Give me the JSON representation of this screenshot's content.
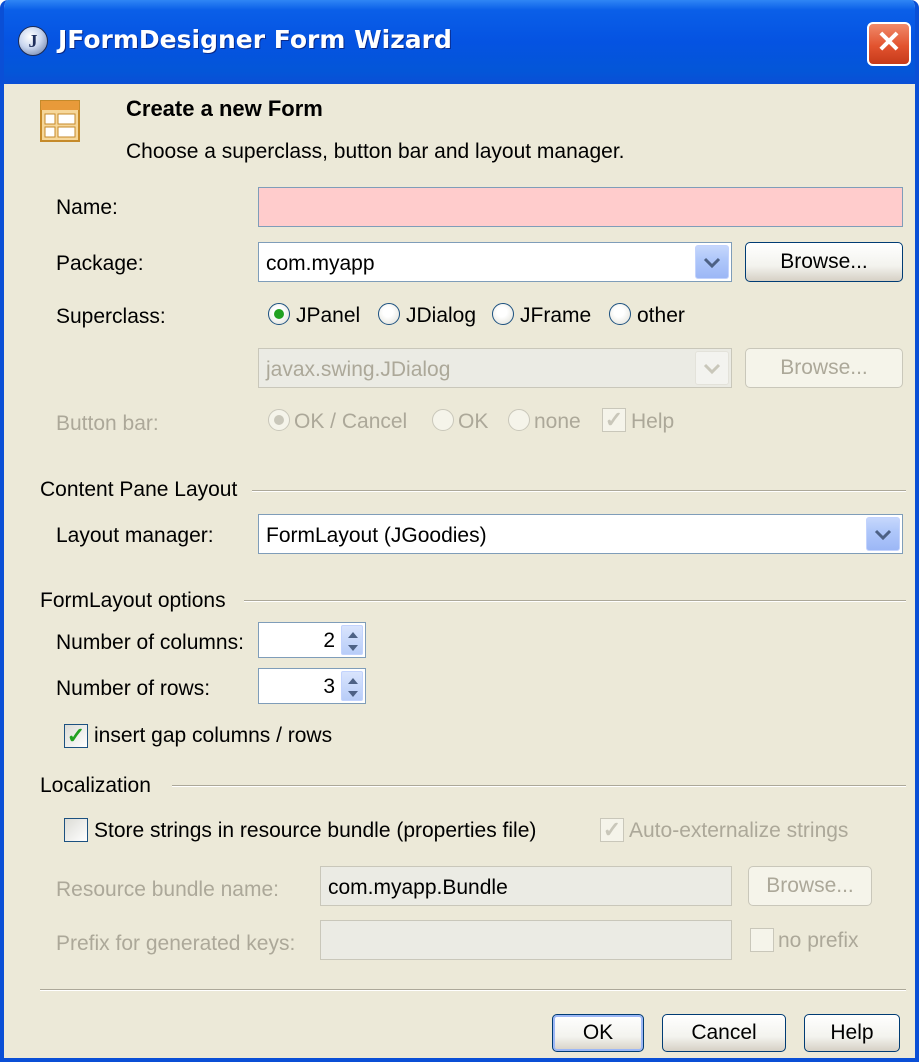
{
  "window": {
    "title": "JFormDesigner Form Wizard",
    "close_label": "✕"
  },
  "header": {
    "icon": "form-layout-icon",
    "title": "Create a new Form",
    "subtitle": "Choose a superclass, button bar and layout manager."
  },
  "form": {
    "name_label": "Name:",
    "name_value": "",
    "package_label": "Package:",
    "package_value": "com.myapp",
    "package_browse": "Browse...",
    "superclass_label": "Superclass:",
    "superclass_options": [
      "JPanel",
      "JDialog",
      "JFrame",
      "other"
    ],
    "superclass_selected": "JPanel",
    "other_class_value": "javax.swing.JDialog",
    "other_browse": "Browse...",
    "button_bar_label": "Button bar:",
    "button_bar_options": [
      "OK / Cancel",
      "OK",
      "none"
    ],
    "button_bar_selected": "OK / Cancel",
    "help_label": "Help",
    "help_checked": true
  },
  "content_pane": {
    "section_title": "Content Pane Layout",
    "layout_manager_label": "Layout manager:",
    "layout_manager_value": "FormLayout (JGoodies)"
  },
  "formlayout_options": {
    "section_title": "FormLayout options",
    "columns_label": "Number of columns:",
    "columns_value": "2",
    "rows_label": "Number of rows:",
    "rows_value": "3",
    "insert_gap_label": "insert gap columns / rows",
    "insert_gap_checked": true
  },
  "localization": {
    "section_title": "Localization",
    "store_strings_label": "Store strings in resource bundle (properties file)",
    "store_strings_checked": false,
    "auto_externalize_label": "Auto-externalize strings",
    "auto_externalize_checked": true,
    "bundle_name_label": "Resource bundle name:",
    "bundle_name_value": "com.myapp.Bundle",
    "bundle_browse": "Browse...",
    "prefix_label": "Prefix for generated keys:",
    "prefix_value": "",
    "no_prefix_label": "no prefix",
    "no_prefix_checked": false
  },
  "buttons": {
    "ok": "OK",
    "cancel": "Cancel",
    "help": "Help"
  },
  "colors": {
    "title_bar": "#0553e2",
    "dialog_bg": "#ece9d8",
    "error_field": "#ffcccc",
    "check_green": "#21a121"
  }
}
